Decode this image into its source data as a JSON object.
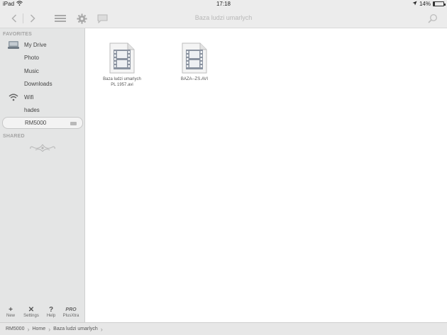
{
  "statusbar": {
    "device": "iPad",
    "time": "17:18",
    "battery": "14%",
    "battery_level": 0.14
  },
  "toolbar": {
    "title": "Baza ludzi umarlych",
    "icons": [
      "back-icon",
      "forward-icon",
      "list-view-icon",
      "gear-icon",
      "chat-icon",
      "search-icon"
    ]
  },
  "sidebar": {
    "favorites_label": "FAVORITES",
    "shared_label": "SHARED",
    "items": [
      {
        "label": "My Drive",
        "icon": "drive-icon"
      },
      {
        "label": "Photo"
      },
      {
        "label": "Music"
      },
      {
        "label": "Downloads"
      },
      {
        "label": "Wifi",
        "icon": "wifi-icon"
      },
      {
        "label": "hades"
      },
      {
        "label": "RM5000",
        "selected": true
      }
    ],
    "bottom": [
      {
        "glyph": "+",
        "label": "New"
      },
      {
        "glyph": "✕",
        "label": "Settings"
      },
      {
        "glyph": "?",
        "label": "Help"
      },
      {
        "glyph": "PRO",
        "label": "PlusXtra"
      }
    ]
  },
  "files": [
    {
      "name_line1": "Baza ludzi umarlych",
      "name_line2": "PL 1957.avi"
    },
    {
      "name_line1": "BAZA--ZS.AVI",
      "name_line2": ""
    }
  ],
  "breadcrumb": [
    "RM5000",
    "Home",
    "Baza ludzi umarlych"
  ]
}
